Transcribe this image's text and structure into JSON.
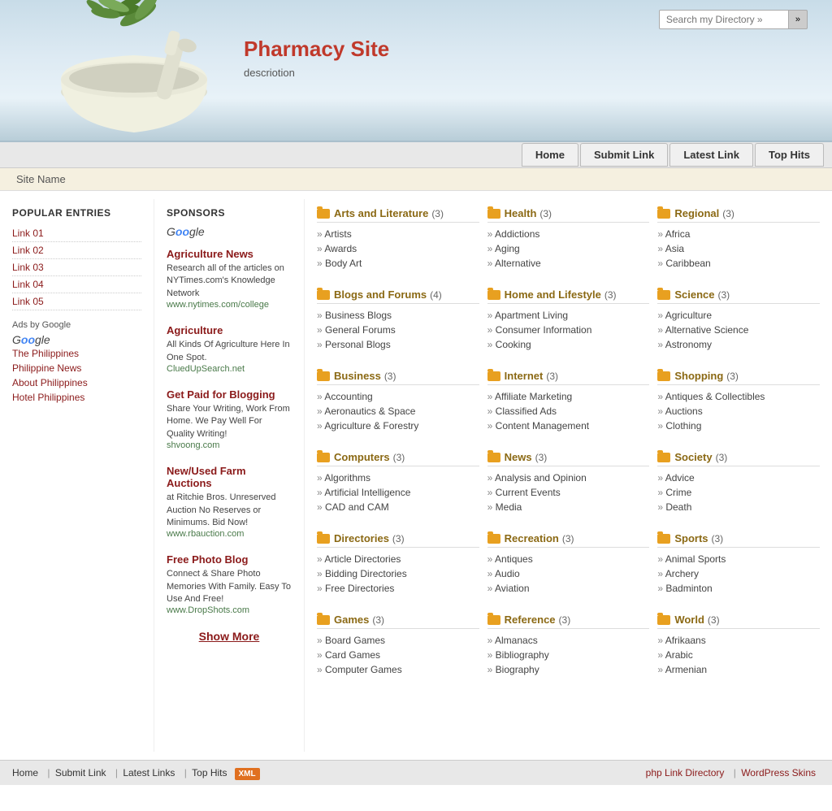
{
  "header": {
    "site_title": "Pharmacy Site",
    "site_desc": "descriotion",
    "search_placeholder": "Search my Directory »"
  },
  "navbar": {
    "items": [
      "Home",
      "Submit Link",
      "Latest Link",
      "Top Hits"
    ]
  },
  "sitename": "Site Name",
  "sidebar": {
    "popular_title": "POPULAR ENTRIES",
    "popular_links": [
      "Link 01",
      "Link 02",
      "Link 03",
      "Link 04",
      "Link 05"
    ],
    "ads_label": "Ads by Google",
    "geo_links": [
      "The Philippines",
      "Philippine News",
      "About Philippines",
      "Hotel Philippines"
    ],
    "sponsors_title": "SPONSORS",
    "sponsors_ads": "Ads by Google",
    "sponsors": [
      {
        "title": "Agriculture News",
        "desc": "Research all of the articles on NYTimes.com's Knowledge Network",
        "url": "www.nytimes.com/college"
      },
      {
        "title": "Agriculture",
        "desc": "All Kinds Of Agriculture Here In One Spot.",
        "url": "CluedUpSearch.net"
      },
      {
        "title": "Get Paid for Blogging",
        "desc": "Share Your Writing, Work From Home. We Pay Well For Quality Writing!",
        "url": "shvoong.com"
      },
      {
        "title": "New/Used Farm Auctions",
        "desc": "at Ritchie Bros. Unreserved Auction No Reserves or Minimums. Bid Now!",
        "url": "www.rbauction.com"
      },
      {
        "title": "Free Photo Blog",
        "desc": "Connect & Share Photo Memories With Family. Easy To Use And Free!",
        "url": "www.DropShots.com"
      }
    ],
    "show_more": "Show More"
  },
  "categories": [
    {
      "title": "Arts and Literature",
      "count": "(3)",
      "items": [
        "Artists",
        "Awards",
        "Body Art"
      ]
    },
    {
      "title": "Health",
      "count": "(3)",
      "items": [
        "Addictions",
        "Aging",
        "Alternative"
      ]
    },
    {
      "title": "Regional",
      "count": "(3)",
      "items": [
        "Africa",
        "Asia",
        "Caribbean"
      ]
    },
    {
      "title": "Blogs and Forums",
      "count": "(4)",
      "items": [
        "Business Blogs",
        "General Forums",
        "Personal Blogs"
      ]
    },
    {
      "title": "Home and Lifestyle",
      "count": "(3)",
      "items": [
        "Apartment Living",
        "Consumer Information",
        "Cooking"
      ]
    },
    {
      "title": "Science",
      "count": "(3)",
      "items": [
        "Agriculture",
        "Alternative Science",
        "Astronomy"
      ]
    },
    {
      "title": "Business",
      "count": "(3)",
      "items": [
        "Accounting",
        "Aeronautics & Space",
        "Agriculture & Forestry"
      ]
    },
    {
      "title": "Internet",
      "count": "(3)",
      "items": [
        "Affiliate Marketing",
        "Classified Ads",
        "Content Management"
      ]
    },
    {
      "title": "Shopping",
      "count": "(3)",
      "items": [
        "Antiques & Collectibles",
        "Auctions",
        "Clothing"
      ]
    },
    {
      "title": "Computers",
      "count": "(3)",
      "items": [
        "Algorithms",
        "Artificial Intelligence",
        "CAD and CAM"
      ]
    },
    {
      "title": "News",
      "count": "(3)",
      "items": [
        "Analysis and Opinion",
        "Current Events",
        "Media"
      ]
    },
    {
      "title": "Society",
      "count": "(3)",
      "items": [
        "Advice",
        "Crime",
        "Death"
      ]
    },
    {
      "title": "Directories",
      "count": "(3)",
      "items": [
        "Article Directories",
        "Bidding Directories",
        "Free Directories"
      ]
    },
    {
      "title": "Recreation",
      "count": "(3)",
      "items": [
        "Antiques",
        "Audio",
        "Aviation"
      ]
    },
    {
      "title": "Sports",
      "count": "(3)",
      "items": [
        "Animal Sports",
        "Archery",
        "Badminton"
      ]
    },
    {
      "title": "Games",
      "count": "(3)",
      "items": [
        "Board Games",
        "Card Games",
        "Computer Games"
      ]
    },
    {
      "title": "Reference",
      "count": "(3)",
      "items": [
        "Almanacs",
        "Bibliography",
        "Biography"
      ]
    },
    {
      "title": "World",
      "count": "(3)",
      "items": [
        "Afrikaans",
        "Arabic",
        "Armenian"
      ]
    }
  ],
  "footer": {
    "left_links": [
      "Home",
      "Submit Link",
      "Latest Links",
      "Top Hits"
    ],
    "xml_label": "XML",
    "right_links": [
      "php Link Directory",
      "WordPress Skins"
    ]
  }
}
